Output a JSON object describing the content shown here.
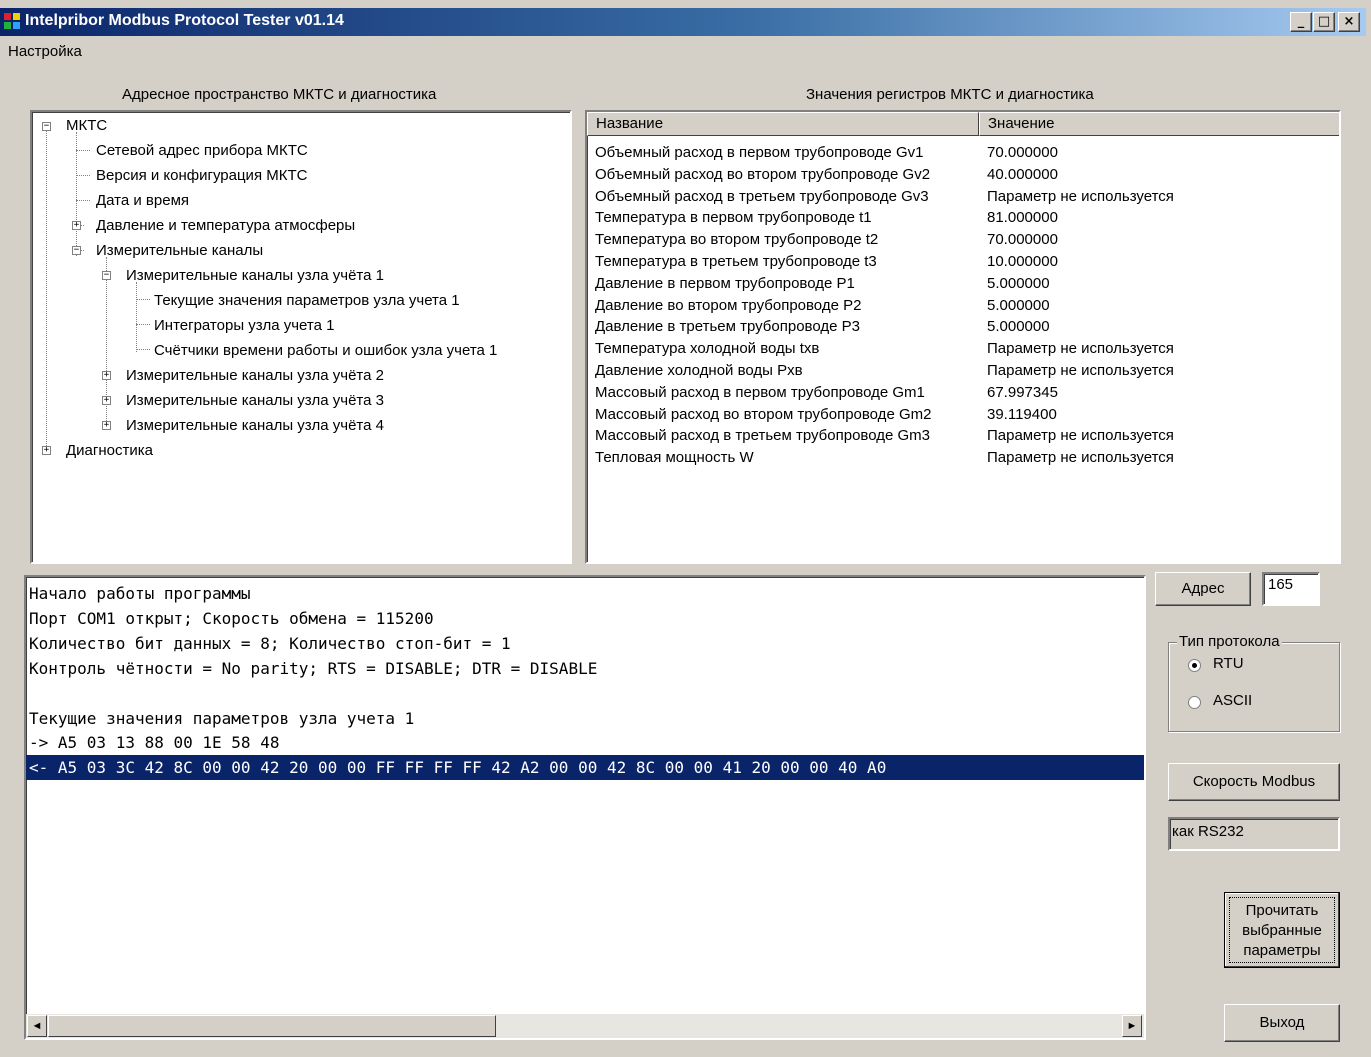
{
  "window": {
    "title": "Intelpribor Modbus Protocol Tester v01.14",
    "icon": "modbus-app-icon",
    "controls": {
      "minimize": "_",
      "maximize": "□",
      "close": "×"
    }
  },
  "menu": {
    "settings": "Настройка"
  },
  "tree_panel": {
    "caption": "Адресное пространство МКТС и диагностика",
    "nodes": [
      {
        "label": "МКТС",
        "expander": "−"
      },
      {
        "label": "Сетевой адрес прибора МКТС"
      },
      {
        "label": "Версия и конфигурация МКТС"
      },
      {
        "label": "Дата и время"
      },
      {
        "label": "Давление и температура атмосферы",
        "expander": "+"
      },
      {
        "label": "Измерительные каналы",
        "expander": "−"
      },
      {
        "label": "Измерительные каналы узла учёта 1",
        "expander": "−"
      },
      {
        "label": "Текущие значения параметров узла учета 1"
      },
      {
        "label": "Интеграторы узла учета 1"
      },
      {
        "label": "Счётчики  времени работы и ошибок узла учета 1"
      },
      {
        "label": "Измерительные каналы узла учёта 2",
        "expander": "+"
      },
      {
        "label": "Измерительные каналы узла учёта 3",
        "expander": "+"
      },
      {
        "label": "Измерительные каналы узла учёта 4",
        "expander": "+"
      },
      {
        "label": "Диагностика",
        "expander": "+"
      }
    ]
  },
  "registers_panel": {
    "caption": "Значения регистров МКТС и диагностика",
    "headers": {
      "name": "Название",
      "value": "Значение"
    },
    "rows": [
      {
        "name": "Объемный расход в первом трубопроводе Gv1",
        "value": "70.000000"
      },
      {
        "name": "Объемный расход во втором трубопроводе Gv2",
        "value": "40.000000"
      },
      {
        "name": "Объемный расход в третьем трубопроводе Gv3",
        "value": "Параметр не используется"
      },
      {
        "name": "Температура в первом трубопроводе t1",
        "value": "81.000000"
      },
      {
        "name": "Температура во втором трубопроводе t2",
        "value": "70.000000"
      },
      {
        "name": "Температура в третьем трубопроводе t3",
        "value": "10.000000"
      },
      {
        "name": "Давление в первом трубопроводе P1",
        "value": "5.000000"
      },
      {
        "name": "Давление во втором трубопроводе P2",
        "value": "5.000000"
      },
      {
        "name": "Давление в третьем трубопроводе P3",
        "value": "5.000000"
      },
      {
        "name": "Температура холодной воды txв",
        "value": "Параметр не используется"
      },
      {
        "name": "Давление холодной воды Pxв",
        "value": "Параметр не используется"
      },
      {
        "name": "Массовый расход в первом трубопроводе Gm1",
        "value": "67.997345"
      },
      {
        "name": "Массовый расход во втором трубопроводе Gm2",
        "value": "39.119400"
      },
      {
        "name": "Массовый расход в третьем трубопроводе Gm3",
        "value": "Параметр не используется"
      },
      {
        "name": "Тепловая мощность W",
        "value": "Параметр не используется"
      }
    ]
  },
  "log": {
    "lines": [
      "Начало работы программы",
      "Порт COM1 открыт; Скорость обмена = 115200",
      "Количество бит данных = 8; Количество стоп-бит = 1",
      "Контроль чётности = No parity; RTS = DISABLE; DTR = DISABLE",
      "",
      "Текущие значения параметров узла учета 1",
      "-> A5 03 13 88 00 1E 58 48",
      "<- A5 03 3C 42 8C 00 00 42 20 00 00 FF FF FF FF 42 A2 00 00 42 8C 00 00 41 20 00 00 40 A0"
    ],
    "selected_index": 7,
    "scroll_left": "◄",
    "scroll_right": "►"
  },
  "controls": {
    "address_button": "Адрес",
    "address_value": "165",
    "protocol_group": "Тип протокола",
    "protocol_rtu": "RTU",
    "protocol_ascii": "ASCII",
    "protocol_selected": "RTU",
    "speed_button": "Скорость Modbus",
    "speed_value": "как RS232",
    "read_button_line1": "Прочитать",
    "read_button_line2": "выбранные",
    "read_button_line3": "параметры",
    "exit_button": "Выход"
  }
}
